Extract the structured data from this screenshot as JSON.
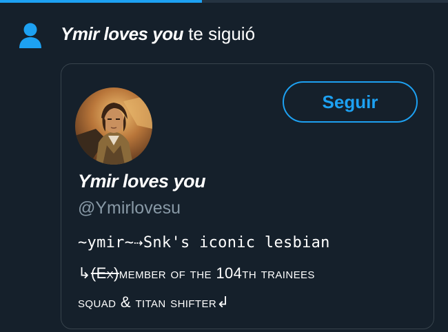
{
  "progress": {
    "fraction": 0.45
  },
  "notification": {
    "icon": "person-icon",
    "name": "Ymir loves you",
    "action": " te siguió"
  },
  "profile": {
    "display_name": "Ymir loves you",
    "handle": "@Ymirlovesu",
    "follow_label": "Seguir",
    "bio": {
      "line1": "~ymir~⇢Snk's iconic lesbian",
      "line2_prefix": "↳",
      "line2_struck": "(Ex)",
      "line2_rest": "member of the 104th trainees",
      "line3": "squad & titan shifter↲"
    }
  },
  "colors": {
    "background": "#15202b",
    "accent": "#1da1f2",
    "secondary_text": "#8899a6",
    "border": "#38444d"
  }
}
